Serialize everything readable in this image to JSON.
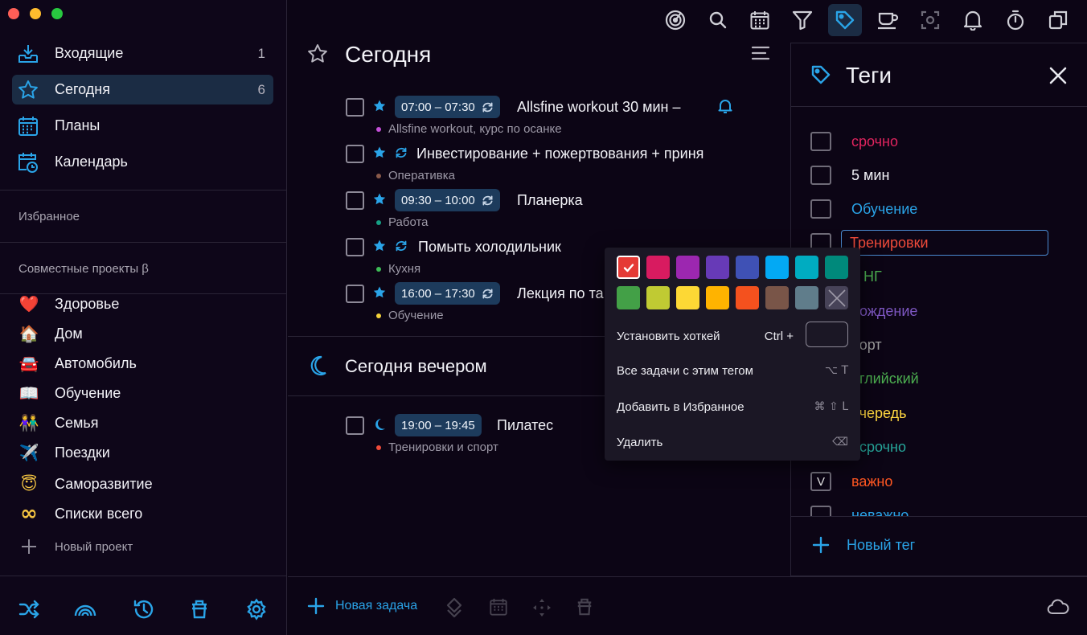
{
  "window": {
    "traffic_colors": [
      "#fe5f57",
      "#febc2e",
      "#28c840"
    ]
  },
  "sidebar": {
    "nav": [
      {
        "label": "Входящие",
        "count": "1",
        "icon": "inbox-icon"
      },
      {
        "label": "Сегодня",
        "count": "6",
        "icon": "star-icon"
      },
      {
        "label": "Планы",
        "count": "",
        "icon": "plans-icon"
      },
      {
        "label": "Календарь",
        "count": "",
        "icon": "calendar-clock-icon"
      }
    ],
    "favorites_label": "Избранное",
    "shared_label": "Совместные проекты β",
    "projects": [
      {
        "emoji": "❤️",
        "label": "Здоровье"
      },
      {
        "emoji": "🏠",
        "label": "Дом"
      },
      {
        "emoji": "🚘",
        "label": "Автомобиль"
      },
      {
        "emoji": "📖",
        "label": "Обучение"
      },
      {
        "emoji": "👫",
        "label": "Семья"
      },
      {
        "emoji": "✈️",
        "label": "Поездки"
      },
      {
        "emoji": "😇",
        "label": "Саморазвитие"
      },
      {
        "emoji": "∞",
        "label": "Списки всего"
      }
    ],
    "new_project": "Новый проект",
    "bottom_icons": [
      "shuffle-icon",
      "rainbow-icon",
      "history-icon",
      "trash-icon",
      "settings-icon"
    ]
  },
  "toolbar": {
    "icons": [
      "radar-icon",
      "search-icon",
      "calendar-icon",
      "filter-icon",
      "tag-icon",
      "coffee-icon",
      "focus-icon",
      "bell-icon",
      "timer-icon",
      "copy-icon"
    ],
    "active": "tag-icon"
  },
  "today": {
    "title": "Сегодня",
    "tasks": [
      {
        "time": "07:00 – 07:30",
        "title": "Allsfine workout 30 мин –",
        "project": "Allsfine workout, курс по осанке",
        "dot": "#c450d8",
        "repeat": true,
        "bell": true
      },
      {
        "time": "",
        "title": "Инвестирование + пожертвования + приня",
        "project": "Оперативка",
        "dot": "#8a5a4a",
        "repeat": true,
        "bell": false
      },
      {
        "time": "09:30 – 10:00",
        "title": "Планерка",
        "project": "Работа",
        "dot": "#16a085",
        "repeat": true,
        "bell": false
      },
      {
        "time": "",
        "title": "Помыть холодильник",
        "project": "Кухня",
        "dot": "#3dbb56",
        "repeat": true,
        "bell": false
      },
      {
        "time": "16:00 – 17:30",
        "title": "Лекция по та",
        "project": "Обучение",
        "dot": "#f5d33a",
        "repeat": true,
        "bell": false
      }
    ]
  },
  "evening": {
    "title": "Сегодня вечером",
    "tasks": [
      {
        "time": "19:00 – 19:45",
        "title": "Пилатес",
        "project": "Тренировки и спорт",
        "dot": "#f04b3a"
      }
    ]
  },
  "footer": {
    "new_task": "Новая задача",
    "icons": [
      "priority-icon",
      "calendar-icon",
      "move-icon",
      "trash-icon",
      "cloud-icon"
    ]
  },
  "tags_panel": {
    "title": "Теги",
    "tags": [
      {
        "label": "срочно",
        "color": "#e0245e",
        "check": ""
      },
      {
        "label": "5 мин",
        "color": "#f2f2f7",
        "check": ""
      },
      {
        "label": "Обучение",
        "color": "#2aa4e8",
        "check": ""
      },
      {
        "label": "Тренировки",
        "color": "#f04b3a",
        "check": ""
      },
      {
        "label": "о НГ",
        "color": "#4caf50",
        "check": ""
      },
      {
        "label": "рождение",
        "color": "#7e57c2",
        "check": ""
      },
      {
        "label": "порт",
        "color": "#9e9e9e",
        "check": ""
      },
      {
        "label": "нглийский",
        "color": "#4caf50",
        "check": ""
      },
      {
        "label": "очередь",
        "color": "#ffd740",
        "check": ""
      },
      {
        "label": "есрочно",
        "color": "#26a69a",
        "check": ""
      },
      {
        "label": "важно",
        "color": "#ff5722",
        "check": "V"
      },
      {
        "label": "неважно",
        "color": "#2aa4e8",
        "check": ""
      }
    ],
    "new_tag": "Новый тег"
  },
  "context_menu": {
    "colors": [
      "#e53935",
      "#d81b60",
      "#9c27b0",
      "#673ab7",
      "#3f51b5",
      "#03a9f4",
      "#00acc1",
      "#00897b",
      "#43a047",
      "#c0ca33",
      "#fdd835",
      "#ffb300",
      "#f4511e",
      "#795548",
      "#607d8b",
      "#none"
    ],
    "selected_color": "#e53935",
    "hotkey_label": "Установить хоткей",
    "hotkey_prefix": "Ctrl +",
    "items": [
      {
        "label": "Все задачи с этим тегом",
        "shortcut": "⌥ T"
      },
      {
        "label": "Добавить в Избранное",
        "shortcut": "⌘ ⇧ L"
      },
      {
        "label": "Удалить",
        "shortcut": "⌫"
      }
    ]
  },
  "colors": {
    "accent": "#2aa4e8",
    "selected": "#1b2c44",
    "chip": "#1d3b5c"
  }
}
